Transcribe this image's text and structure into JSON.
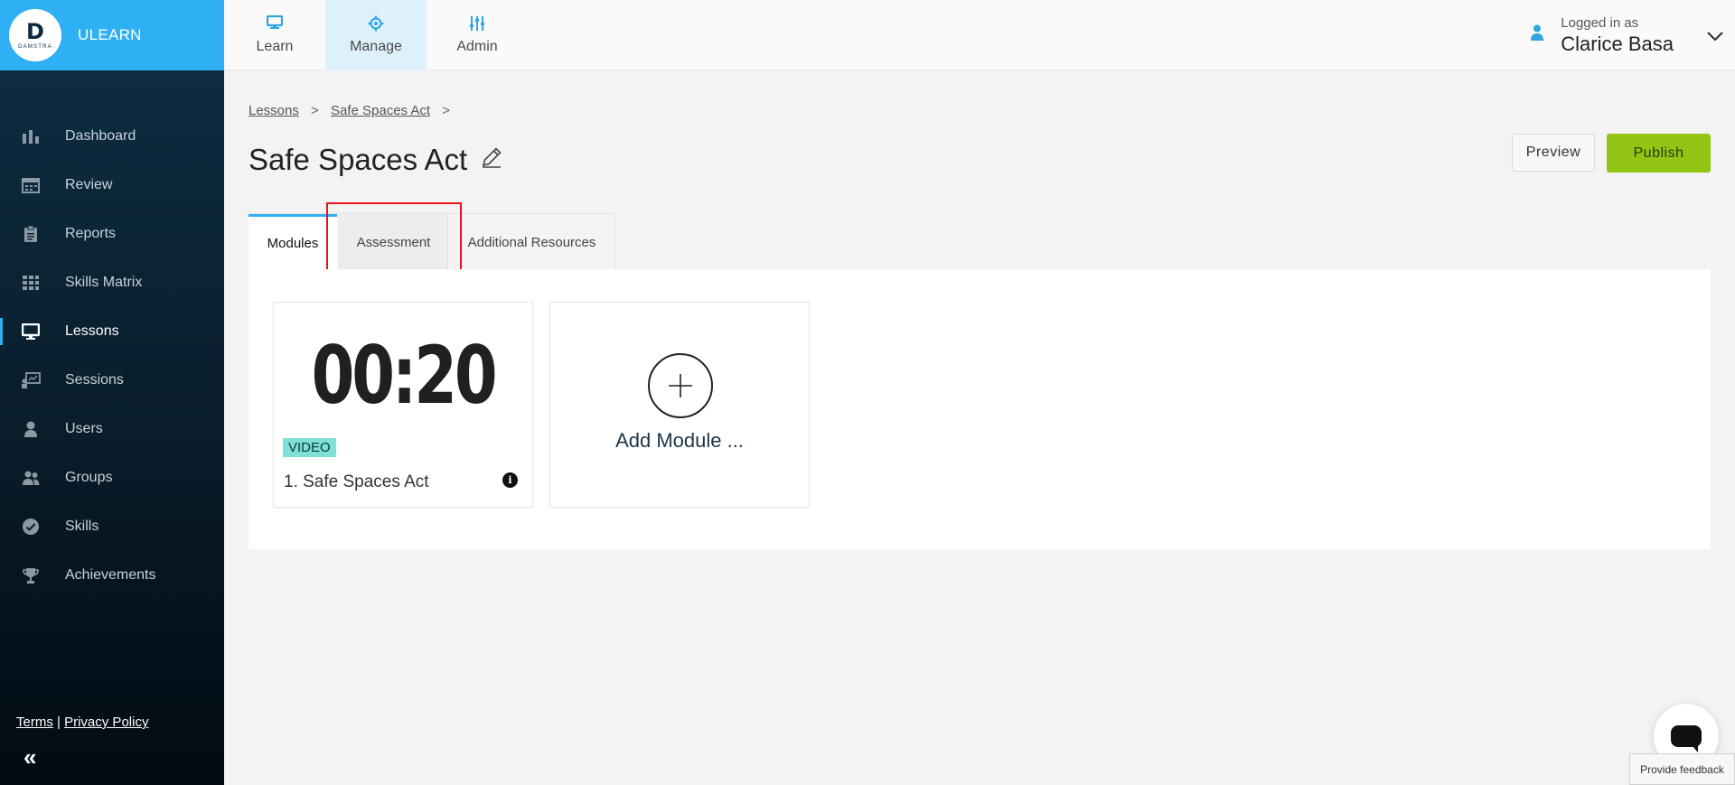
{
  "brand": {
    "logo_word": "DAMSTRA",
    "name": "ULEARN"
  },
  "sidebar": {
    "items": [
      {
        "label": "Dashboard",
        "icon": "bar-chart-icon"
      },
      {
        "label": "Review",
        "icon": "calendar-icon"
      },
      {
        "label": "Reports",
        "icon": "clipboard-icon"
      },
      {
        "label": "Skills Matrix",
        "icon": "grid-icon"
      },
      {
        "label": "Lessons",
        "icon": "monitor-icon",
        "active": true
      },
      {
        "label": "Sessions",
        "icon": "presentation-icon"
      },
      {
        "label": "Users",
        "icon": "user-icon"
      },
      {
        "label": "Groups",
        "icon": "users-icon"
      },
      {
        "label": "Skills",
        "icon": "check-circle-icon"
      },
      {
        "label": "Achievements",
        "icon": "trophy-icon"
      }
    ],
    "terms": "Terms",
    "separator": "|",
    "privacy": "Privacy Policy"
  },
  "topnav": {
    "tabs": [
      {
        "label": "Learn",
        "icon": "monitor-icon"
      },
      {
        "label": "Manage",
        "icon": "gear-icon",
        "active": true
      },
      {
        "label": "Admin",
        "icon": "sliders-icon"
      }
    ]
  },
  "user": {
    "logged_in_label": "Logged in as",
    "name": "Clarice Basa"
  },
  "breadcrumb": {
    "items": [
      "Lessons",
      "Safe Spaces Act"
    ],
    "sep": ">"
  },
  "page": {
    "title": "Safe Spaces Act"
  },
  "actions": {
    "preview": "Preview",
    "publish": "Publish"
  },
  "tabs": [
    {
      "label": "Modules",
      "active": true
    },
    {
      "label": "Assessment"
    },
    {
      "label": "Additional Resources"
    }
  ],
  "modules": [
    {
      "thumbnail_text": "00:20",
      "type": "VIDEO",
      "title": "1. Safe Spaces Act"
    }
  ],
  "add_module": {
    "label": "Add Module ..."
  },
  "feedback": {
    "label": "Provide feedback"
  },
  "colors": {
    "accent": "#2fb0f5",
    "publish": "#93c614",
    "highlight": "#e8141a",
    "badge": "#7ee0d7"
  }
}
